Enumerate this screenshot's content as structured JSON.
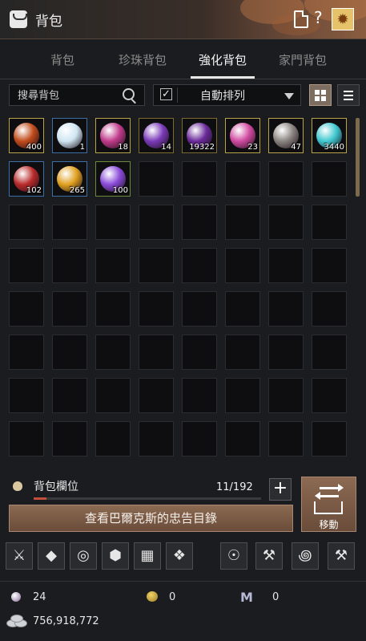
{
  "window": {
    "title": "背包"
  },
  "tabs": [
    {
      "label": "背包",
      "active": false
    },
    {
      "label": "珍珠背包",
      "active": false
    },
    {
      "label": "強化背包",
      "active": true
    },
    {
      "label": "家門背包",
      "active": false
    }
  ],
  "search": {
    "placeholder": "搜尋背包"
  },
  "sort": {
    "label": "自動排列",
    "checked": true
  },
  "items": [
    {
      "name": "gold-red-crystal",
      "count": "400",
      "color": "#c04a1a"
    },
    {
      "name": "white-crystal",
      "count": "1",
      "color": "#cfe6f2"
    },
    {
      "name": "pink-stone",
      "count": "18",
      "color": "#c03a8a"
    },
    {
      "name": "purple-stone",
      "count": "14",
      "color": "#7a3ab8"
    },
    {
      "name": "purple-shard",
      "count": "19322",
      "color": "#6a2a9a"
    },
    {
      "name": "pink-vortex",
      "count": "23",
      "color": "#d04aa0"
    },
    {
      "name": "gray-stone",
      "count": "47",
      "color": "#8a8480"
    },
    {
      "name": "cyan-orb",
      "count": "3440",
      "color": "#40c8d0"
    },
    {
      "name": "red-stone",
      "count": "102",
      "color": "#b82a2a"
    },
    {
      "name": "gold-flame",
      "count": "265",
      "color": "#e0a020"
    },
    {
      "name": "violet-stone",
      "count": "100",
      "color": "#8a4ad8"
    }
  ],
  "capacity": {
    "label": "背包欄位",
    "count": "11/192",
    "fill": 0.057
  },
  "advice_button": {
    "label": "查看巴爾克斯的忠告目錄"
  },
  "move_button": {
    "label": "移動"
  },
  "toolbar": [
    {
      "icon": "sword-icon",
      "glyph": "⚔"
    },
    {
      "icon": "diamond-icon",
      "glyph": "◆"
    },
    {
      "icon": "ring-cycle-icon",
      "glyph": "◎"
    },
    {
      "icon": "hexagon-icon",
      "glyph": "⬢"
    },
    {
      "icon": "grid-icon",
      "glyph": "▦"
    },
    {
      "icon": "crystals-icon",
      "glyph": "❖"
    },
    {
      "icon": "lantern-icon",
      "glyph": "☉"
    },
    {
      "icon": "hammer-icon",
      "glyph": "⚒"
    },
    {
      "icon": "swirl-icon",
      "glyph": "꩜"
    },
    {
      "icon": "mallet-icon",
      "glyph": "⚒"
    }
  ],
  "currency": {
    "pearl": "24",
    "coin": "0",
    "mileage": "0",
    "silver": "756,918,772"
  },
  "colors": {
    "accent": "#7d6a4a",
    "button": "#7a5a46",
    "title_bg": "#3a2e28"
  }
}
